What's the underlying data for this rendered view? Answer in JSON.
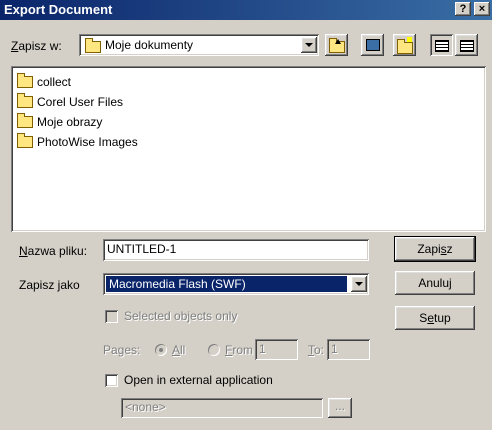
{
  "window": {
    "title": "Export Document",
    "help_label": "?",
    "close_label": "×"
  },
  "lookin": {
    "label_u": "Z",
    "label_rest": "apisz w:",
    "value": "Moje dokumenty"
  },
  "files": [
    {
      "name": "collect"
    },
    {
      "name": "Corel User Files"
    },
    {
      "name": "Moje obrazy"
    },
    {
      "name": "PhotoWise Images"
    }
  ],
  "filename": {
    "label_u": "N",
    "label_rest": "azwa pliku:",
    "value": "UNTITLED-1"
  },
  "filetype": {
    "label": "Zapisz jako",
    "value": "Macromedia Flash (SWF)"
  },
  "buttons": {
    "save_a": "Zapi",
    "save_u": "s",
    "save_b": "z",
    "cancel": "Anuluj",
    "setup_a": "S",
    "setup_u": "e",
    "setup_b": "tup"
  },
  "options": {
    "selected_only": "Selected objects only",
    "pages_label": "Pages:",
    "all_u": "A",
    "all_rest": "ll",
    "from_u": "F",
    "from_rest": "rom",
    "from_value": "1",
    "to_u": "T",
    "to_rest": "o:",
    "to_value": "1",
    "open_external": "Open in external application",
    "app_value": "<none>",
    "browse_label": "..."
  }
}
